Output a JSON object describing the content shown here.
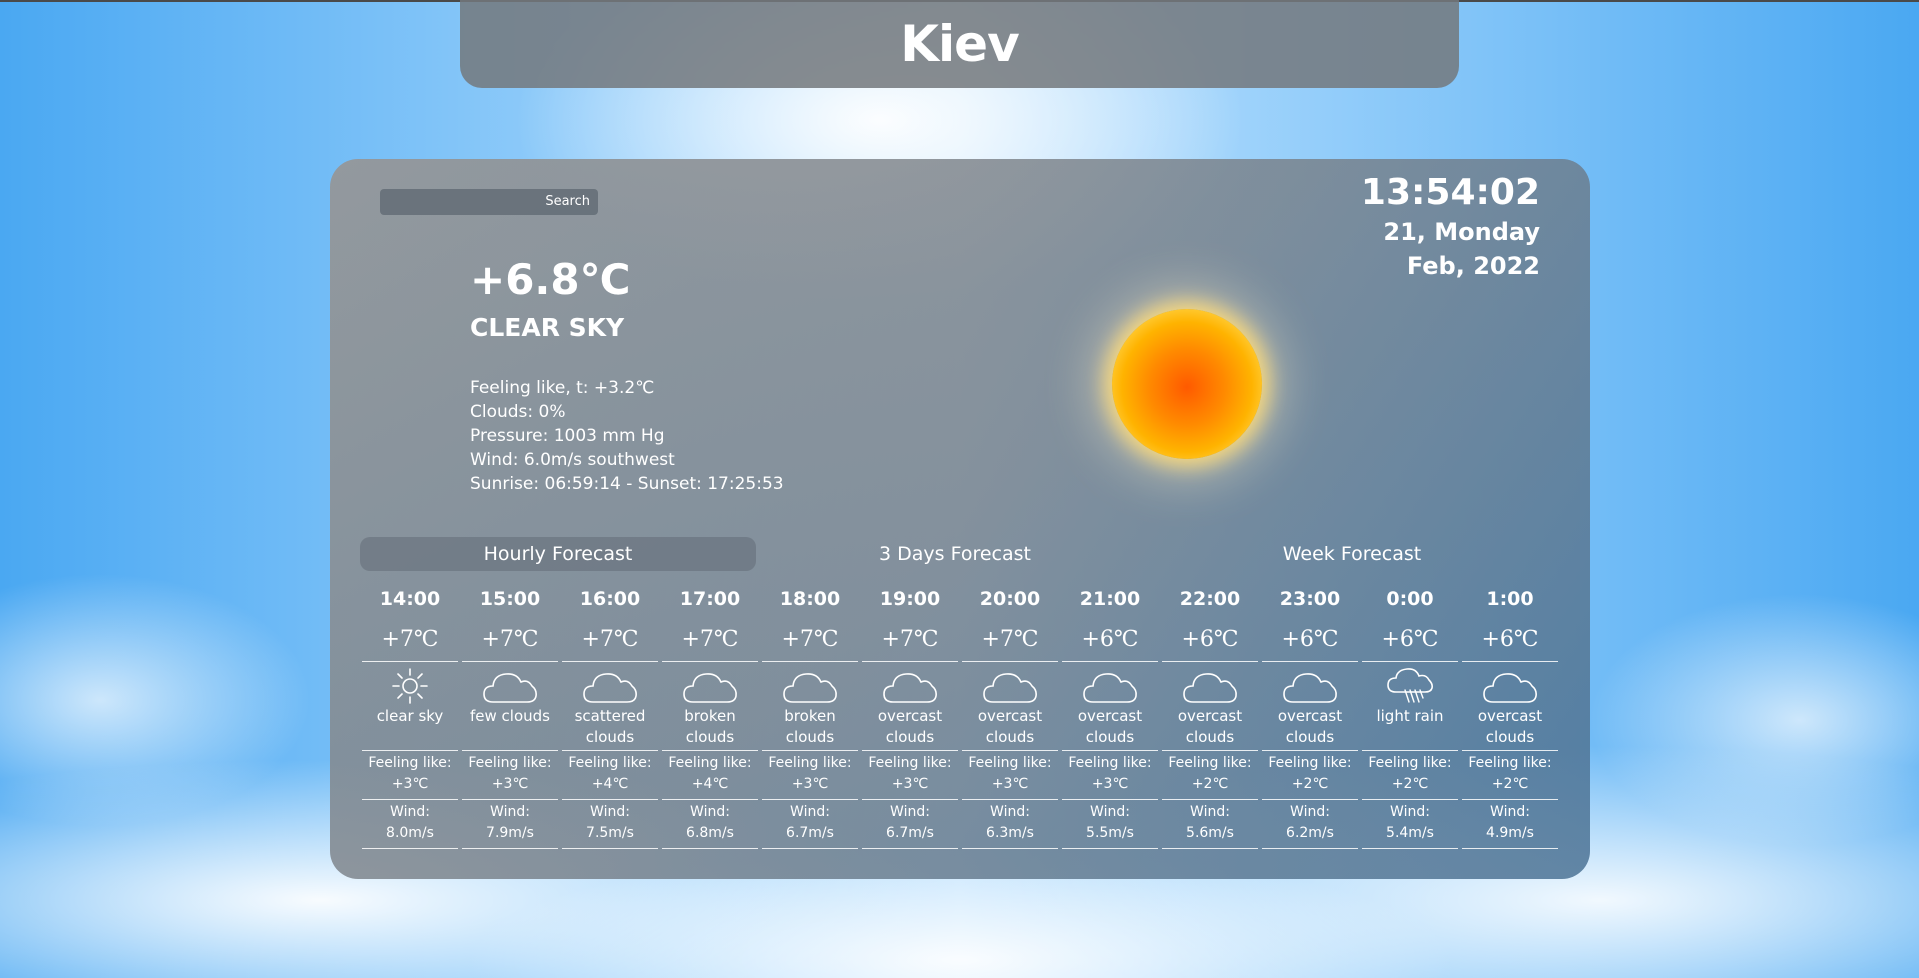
{
  "header": {
    "city": "Kiev"
  },
  "search": {
    "placeholder": "",
    "button_label": "Search"
  },
  "clock": {
    "time": "13:54:02",
    "day": "21, Monday",
    "month_year": "Feb, 2022"
  },
  "current": {
    "temperature": "+6.8℃",
    "condition": "CLEAR SKY",
    "icon": "sun-icon",
    "feeling": "Feeling like, t: +3.2℃",
    "clouds": "Clouds: 0%",
    "pressure": "Pressure: 1003 mm Hg",
    "wind": "Wind: 6.0m/s southwest",
    "sun_times": "Sunrise: 06:59:14 - Sunset: 17:25:53"
  },
  "tabs": [
    {
      "label": "Hourly Forecast",
      "active": true
    },
    {
      "label": "3 Days Forecast",
      "active": false
    },
    {
      "label": "Week Forecast",
      "active": false
    }
  ],
  "hourly": [
    {
      "hour": "14:00",
      "temp": "+7℃",
      "icon": "sun-icon",
      "desc": "clear sky",
      "feel_label": "Feeling like:",
      "feel": "+3℃",
      "wind_label": "Wind:",
      "wind": "8.0m/s"
    },
    {
      "hour": "15:00",
      "temp": "+7℃",
      "icon": "cloud-icon",
      "desc": "few clouds",
      "feel_label": "Feeling like:",
      "feel": "+3℃",
      "wind_label": "Wind:",
      "wind": "7.9m/s"
    },
    {
      "hour": "16:00",
      "temp": "+7℃",
      "icon": "cloud-icon",
      "desc": "scattered clouds",
      "feel_label": "Feeling like:",
      "feel": "+4℃",
      "wind_label": "Wind:",
      "wind": "7.5m/s"
    },
    {
      "hour": "17:00",
      "temp": "+7℃",
      "icon": "cloud-icon",
      "desc": "broken clouds",
      "feel_label": "Feeling like:",
      "feel": "+4℃",
      "wind_label": "Wind:",
      "wind": "6.8m/s"
    },
    {
      "hour": "18:00",
      "temp": "+7℃",
      "icon": "cloud-icon",
      "desc": "broken clouds",
      "feel_label": "Feeling like:",
      "feel": "+3℃",
      "wind_label": "Wind:",
      "wind": "6.7m/s"
    },
    {
      "hour": "19:00",
      "temp": "+7℃",
      "icon": "cloud-icon",
      "desc": "overcast clouds",
      "feel_label": "Feeling like:",
      "feel": "+3℃",
      "wind_label": "Wind:",
      "wind": "6.7m/s"
    },
    {
      "hour": "20:00",
      "temp": "+7℃",
      "icon": "cloud-icon",
      "desc": "overcast clouds",
      "feel_label": "Feeling like:",
      "feel": "+3℃",
      "wind_label": "Wind:",
      "wind": "6.3m/s"
    },
    {
      "hour": "21:00",
      "temp": "+6℃",
      "icon": "cloud-icon",
      "desc": "overcast clouds",
      "feel_label": "Feeling like:",
      "feel": "+3℃",
      "wind_label": "Wind:",
      "wind": "5.5m/s"
    },
    {
      "hour": "22:00",
      "temp": "+6℃",
      "icon": "cloud-icon",
      "desc": "overcast clouds",
      "feel_label": "Feeling like:",
      "feel": "+2℃",
      "wind_label": "Wind:",
      "wind": "5.6m/s"
    },
    {
      "hour": "23:00",
      "temp": "+6℃",
      "icon": "cloud-icon",
      "desc": "overcast clouds",
      "feel_label": "Feeling like:",
      "feel": "+2℃",
      "wind_label": "Wind:",
      "wind": "6.2m/s"
    },
    {
      "hour": "0:00",
      "temp": "+6℃",
      "icon": "rain-cloud-icon",
      "desc": "light rain",
      "feel_label": "Feeling like:",
      "feel": "+2℃",
      "wind_label": "Wind:",
      "wind": "5.4m/s"
    },
    {
      "hour": "1:00",
      "temp": "+6℃",
      "icon": "cloud-icon",
      "desc": "overcast clouds",
      "feel_label": "Feeling like:",
      "feel": "+2℃",
      "wind_label": "Wind:",
      "wind": "4.9m/s"
    }
  ]
}
